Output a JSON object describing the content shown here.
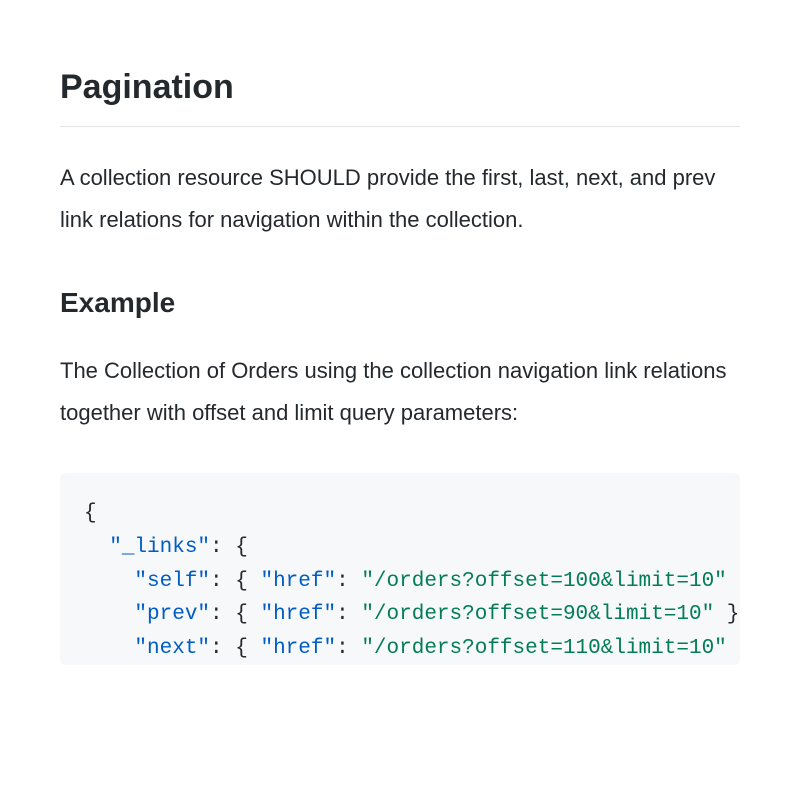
{
  "heading": "Pagination",
  "intro": "A collection resource SHOULD provide the first, last, next, and prev link relations for navigation within the collection.",
  "example_heading": "Example",
  "example_desc": "The Collection of Orders using the collection navigation link relations together with offset and limit query parameters:",
  "code": {
    "links_key": "\"_links\"",
    "self_key": "\"self\"",
    "href_key": "\"href\"",
    "prev_key": "\"prev\"",
    "next_key": "\"next\"",
    "self_val": "\"/orders?offset=100&limit=10\"",
    "prev_val": "\"/orders?offset=90&limit=10\"",
    "next_val": "\"/orders?offset=110&limit=10\""
  }
}
